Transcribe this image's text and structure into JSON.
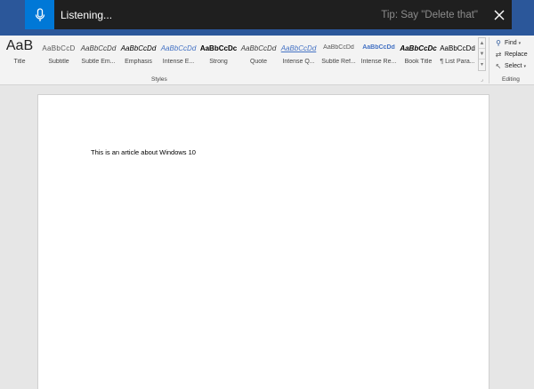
{
  "dictation": {
    "status": "Listening...",
    "tip": "Tip: Say \"Delete that\"",
    "icons": {
      "mic": "microphone-icon",
      "close": "close-icon"
    }
  },
  "ribbon": {
    "styles": [
      {
        "sample": "AaB",
        "name": "Title"
      },
      {
        "sample": "AaBbCcD",
        "name": "Subtitle"
      },
      {
        "sample": "AaBbCcDd",
        "name": "Subtle Em..."
      },
      {
        "sample": "AaBbCcDd",
        "name": "Emphasis"
      },
      {
        "sample": "AaBbCcDd",
        "name": "Intense E..."
      },
      {
        "sample": "AaBbCcDc",
        "name": "Strong"
      },
      {
        "sample": "AaBbCcDd",
        "name": "Quote"
      },
      {
        "sample": "AaBbCcDd",
        "name": "Intense Q..."
      },
      {
        "sample": "AaBbCcDd",
        "name": "Subtle Ref..."
      },
      {
        "sample": "AaBbCcDd",
        "name": "Intense Re..."
      },
      {
        "sample": "AaBbCcDc",
        "name": "Book Title"
      },
      {
        "sample": "AaBbCcDd",
        "name": "¶ List Para..."
      }
    ],
    "styles_group_label": "Styles",
    "editing": {
      "find": "Find",
      "replace": "Replace",
      "select": "Select",
      "group_label": "Editing"
    }
  },
  "document": {
    "text": "This is an article about Windows 10"
  },
  "colors": {
    "ribbon_blue": "#2b579a",
    "dictation_bg": "#1f1f1f",
    "mic_blue": "#0078d7"
  }
}
